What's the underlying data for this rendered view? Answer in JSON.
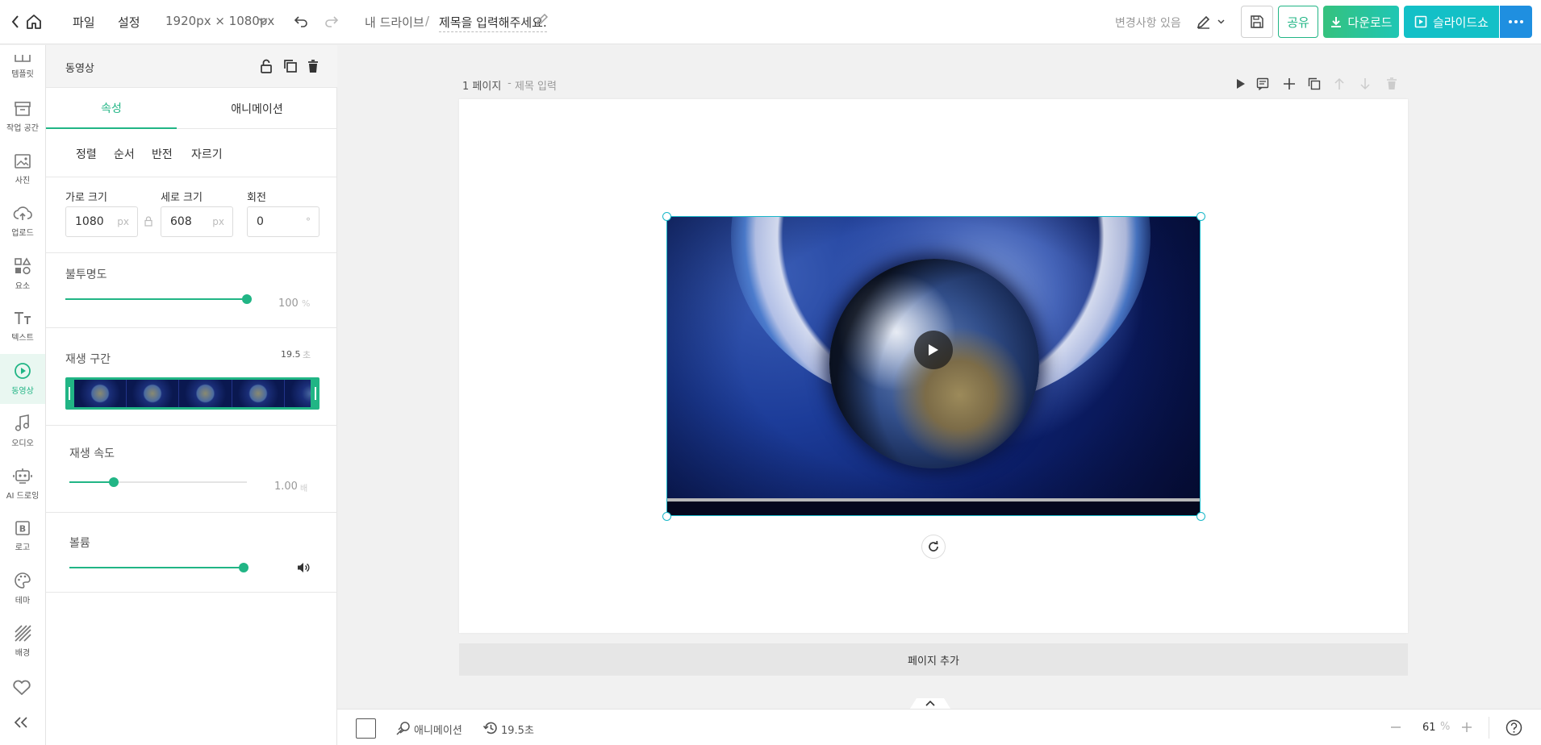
{
  "topbar": {
    "menu_file": "파일",
    "menu_settings": "설정",
    "canvas_size": "1920px × 1080px",
    "breadcrumb_drive": "내 드라이브",
    "breadcrumb_sep": "/",
    "doc_title": "제목을 입력해주세요.",
    "change_status": "변경사항 있음",
    "share_label": "공유",
    "download_label": "다운로드",
    "slideshow_label": "슬라이드쇼"
  },
  "rail": {
    "items": [
      {
        "label": "템플릿",
        "icon": "template-icon"
      },
      {
        "label": "작업 공간",
        "icon": "archive-icon"
      },
      {
        "label": "사진",
        "icon": "image-icon"
      },
      {
        "label": "업로드",
        "icon": "upload-cloud-icon"
      },
      {
        "label": "요소",
        "icon": "shapes-icon"
      },
      {
        "label": "텍스트",
        "icon": "text-icon"
      },
      {
        "label": "동영상",
        "icon": "play-circle-icon",
        "active": true
      },
      {
        "label": "오디오",
        "icon": "music-note-icon"
      },
      {
        "label": "AI 드로잉",
        "icon": "robot-icon"
      },
      {
        "label": "로고",
        "icon": "logo-b-icon"
      },
      {
        "label": "테마",
        "icon": "palette-icon"
      },
      {
        "label": "배경",
        "icon": "hatch-pattern-icon"
      }
    ]
  },
  "panel": {
    "title": "동영상",
    "tab_properties": "속성",
    "tab_animation": "애니메이션",
    "sub_align": "정렬",
    "sub_order": "순서",
    "sub_flip": "반전",
    "sub_crop": "자르기",
    "width_label": "가로 크기",
    "width_value": "1080",
    "height_label": "세로 크기",
    "height_value": "608",
    "rotate_label": "회전",
    "rotate_value": "0",
    "unit_px": "px",
    "unit_deg": "°",
    "opacity_label": "불투명도",
    "opacity_value": "100",
    "opacity_unit": "%",
    "opacity_level": 1.0,
    "playback_label": "재생 구간",
    "playback_value": "19.5",
    "playback_unit": "초",
    "speed_label": "재생 속도",
    "speed_value": "1.00",
    "speed_unit": "배",
    "speed_level": 0.25,
    "volume_label": "볼륨",
    "volume_level": 1.0
  },
  "canvas": {
    "page_number": "1 페이지",
    "page_title_sep": " - ",
    "page_title_placeholder": "제목 입력",
    "add_page": "페이지 추가"
  },
  "bottom": {
    "animation_label": "애니메이션",
    "duration": "19.5초",
    "zoom_value": "61",
    "zoom_unit": "%"
  },
  "colors": {
    "accent": "#21b585",
    "selection": "#18b7c8",
    "slideshow": "#13c0c7"
  }
}
